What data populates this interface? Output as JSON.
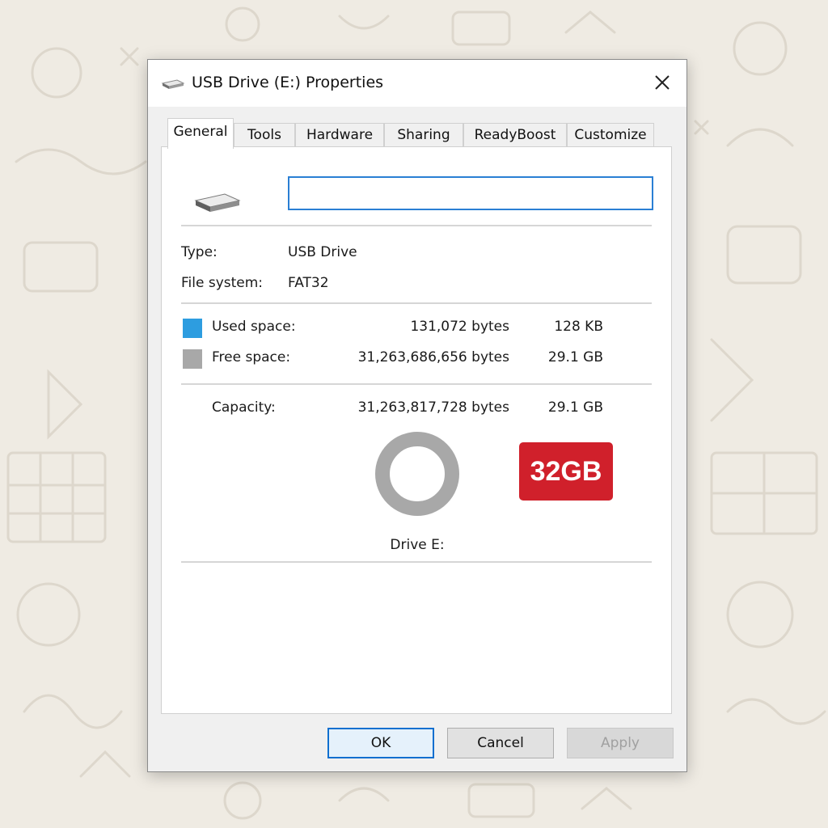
{
  "window": {
    "title": "USB Drive (E:) Properties",
    "close_glyph": "✕"
  },
  "tabs": [
    {
      "label": "General",
      "active": true
    },
    {
      "label": "Tools",
      "active": false
    },
    {
      "label": "Hardware",
      "active": false
    },
    {
      "label": "Sharing",
      "active": false
    },
    {
      "label": "ReadyBoost",
      "active": false
    },
    {
      "label": "Customize",
      "active": false
    }
  ],
  "general": {
    "volume_label_value": "",
    "type_label": "Type:",
    "type_value": "USB Drive",
    "filesystem_label": "File system:",
    "filesystem_value": "FAT32",
    "used": {
      "label": "Used space:",
      "bytes": "131,072 bytes",
      "size": "128 KB",
      "color": "#2d9de0"
    },
    "free": {
      "label": "Free space:",
      "bytes": "31,263,686,656 bytes",
      "size": "29.1 GB",
      "color": "#a8a8a8"
    },
    "capacity": {
      "label": "Capacity:",
      "bytes": "31,263,817,728 bytes",
      "size": "29.1 GB"
    },
    "used_fraction": 4.2e-06,
    "drive_caption": "Drive E:",
    "badge_text": "32GB"
  },
  "buttons": {
    "ok": "OK",
    "cancel": "Cancel",
    "apply": "Apply"
  },
  "colors": {
    "accent": "#2a7fd4",
    "badge": "#d0202b"
  }
}
